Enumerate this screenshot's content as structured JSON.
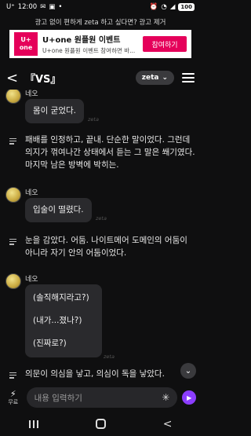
{
  "status": {
    "time": "12:00",
    "carrier": "U⁺",
    "icons": [
      "message-icon",
      "notification-icon",
      "more-icon"
    ],
    "battery": "100"
  },
  "ad": {
    "remove_text": "광고 없이 편하게 zeta 하고 싶다면? 광고 제거",
    "logo": "U+\none",
    "title": "U+one 원플원 이벤트",
    "subtitle": "U+one 원플원 이벤트 참여하면 바...",
    "button": "참여하기"
  },
  "header": {
    "back": "<",
    "title": "『VS』",
    "pill": "zeta",
    "pill_caret": "⌄"
  },
  "watermark": "zeta",
  "messages": [
    {
      "type": "bubble",
      "name": "네오",
      "lines": [
        "몸이 굳었다."
      ]
    },
    {
      "type": "narration",
      "text": "패배를 인정하고, 끝내. 단순한 말이었다. 그런데 의지가 꺾여나간 상태에서 듣는 그 말은 쐐기였다. 마지막 남은 방벽에 박히는."
    },
    {
      "type": "bubble",
      "name": "네오",
      "lines": [
        "입술이 떨렸다."
      ]
    },
    {
      "type": "narration",
      "text": "눈을 감았다. 어둠. 나이트메어 도메인의 어둠이 아니라 자기 안의 어둠이었다."
    },
    {
      "type": "bubble",
      "name": "네오",
      "lines": [
        "(솔직해지라고?)",
        "(내가...졌나?)",
        "(진짜로?)"
      ]
    },
    {
      "type": "narration",
      "text": "의문이 의심을 낳고, 의심이 독을 낳았다."
    }
  ],
  "input": {
    "free_label": "무료",
    "placeholder": "내용 입력하기",
    "star": "✳",
    "send": "▶"
  },
  "scroll_button": "⌄",
  "nav": {
    "back": "<"
  }
}
